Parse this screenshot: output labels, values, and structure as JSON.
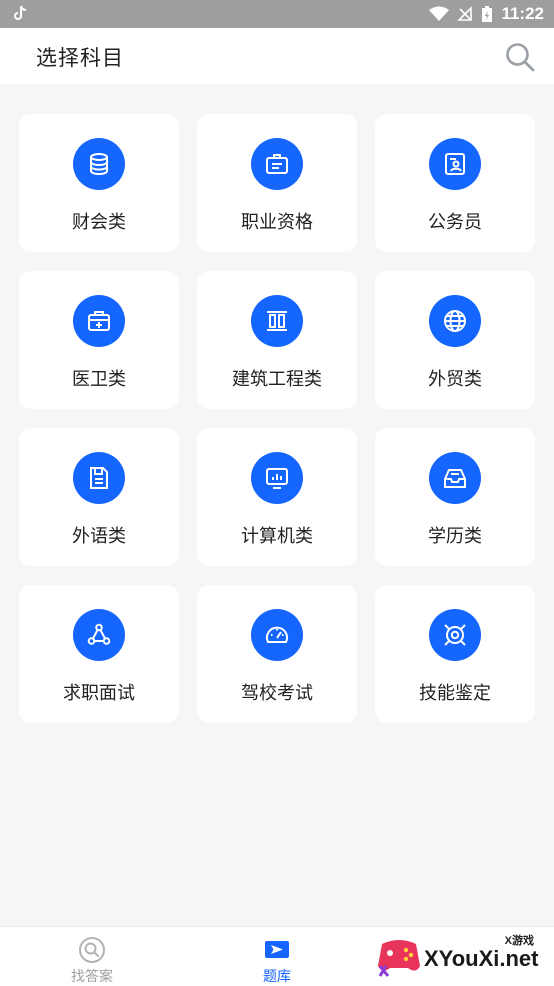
{
  "status_bar": {
    "time": "11:22"
  },
  "header": {
    "title": "选择科目"
  },
  "categories": [
    {
      "label": "财会类",
      "icon": "database-icon"
    },
    {
      "label": "职业资格",
      "icon": "id-badge-icon"
    },
    {
      "label": "公务员",
      "icon": "profile-card-icon"
    },
    {
      "label": "医卫类",
      "icon": "medical-kit-icon"
    },
    {
      "label": "建筑工程类",
      "icon": "building-pillars-icon"
    },
    {
      "label": "外贸类",
      "icon": "globe-icon"
    },
    {
      "label": "外语类",
      "icon": "notebook-icon"
    },
    {
      "label": "计算机类",
      "icon": "monitor-chart-icon"
    },
    {
      "label": "学历类",
      "icon": "inbox-tray-icon"
    },
    {
      "label": "求职面试",
      "icon": "network-nodes-icon"
    },
    {
      "label": "驾校考试",
      "icon": "speedometer-icon"
    },
    {
      "label": "技能鉴定",
      "icon": "target-icon"
    }
  ],
  "tabs": [
    {
      "label": "找答案",
      "icon": "search-circle-icon",
      "active": false
    },
    {
      "label": "题库",
      "icon": "play-flag-icon",
      "active": true
    }
  ],
  "watermark": {
    "small": "X游戏",
    "text": "XYouXi.net"
  },
  "colors": {
    "accent": "#1565ff",
    "inactive": "#9e9e9e",
    "background": "#f5f6f8"
  }
}
